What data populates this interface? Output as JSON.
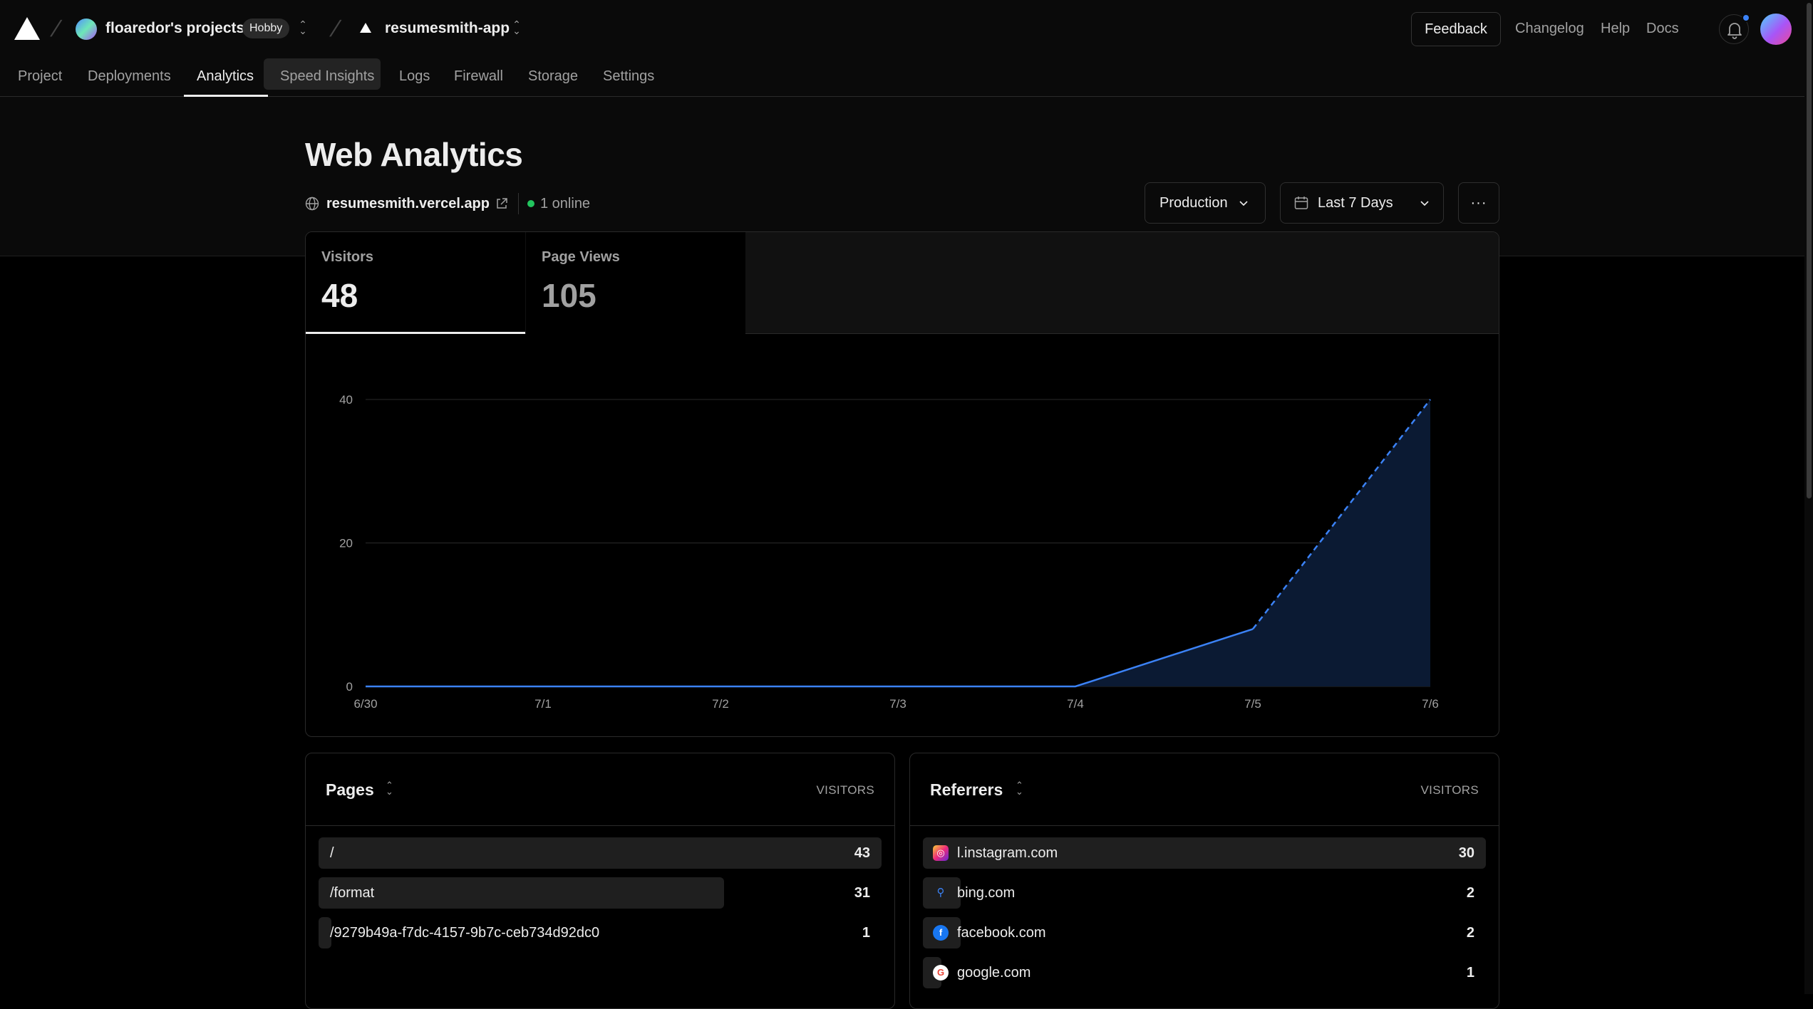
{
  "topbar": {
    "team_name": "floaredor's projects",
    "plan_badge": "Hobby",
    "project_name": "resumesmith-app",
    "feedback_label": "Feedback",
    "links": [
      "Changelog",
      "Help",
      "Docs"
    ]
  },
  "tabs": [
    {
      "label": "Project"
    },
    {
      "label": "Deployments"
    },
    {
      "label": "Analytics",
      "active": true
    },
    {
      "label": "Speed Insights"
    },
    {
      "label": "Logs"
    },
    {
      "label": "Firewall"
    },
    {
      "label": "Storage"
    },
    {
      "label": "Settings"
    }
  ],
  "header": {
    "title": "Web Analytics",
    "domain": "resumesmith.vercel.app",
    "online": "1 online",
    "environment": "Production",
    "range": "Last 7 Days",
    "more_label": "···"
  },
  "stats": [
    {
      "label": "Visitors",
      "value": "48",
      "active": true
    },
    {
      "label": "Page Views",
      "value": "105"
    }
  ],
  "chart_data": {
    "type": "area",
    "title": "",
    "xlabel": "",
    "ylabel": "",
    "categories": [
      "6/30",
      "7/1",
      "7/2",
      "7/3",
      "7/4",
      "7/5",
      "7/6"
    ],
    "ylim": [
      0,
      40
    ],
    "yticks": [
      0,
      20,
      40
    ],
    "grid": true,
    "series": [
      {
        "values": [
          0,
          0,
          0,
          0,
          0,
          8,
          40
        ],
        "color": "#3b82f6",
        "fill": "#0b1a33",
        "dashed_from_index": 5
      }
    ]
  },
  "pages_panel": {
    "title": "Pages",
    "column": "VISITORS",
    "rows": [
      {
        "label": "/",
        "value": "43",
        "share": 1.0
      },
      {
        "label": "/format",
        "value": "31",
        "share": 0.72
      },
      {
        "label": "/9279b49a-f7dc-4157-9b7c-ceb734d92dc0",
        "value": "1",
        "share": 0.023
      }
    ]
  },
  "referrers_panel": {
    "title": "Referrers",
    "column": "VISITORS",
    "rows": [
      {
        "label": "l.instagram.com",
        "value": "30",
        "share": 1.0,
        "icon": "instagram-icon"
      },
      {
        "label": "bing.com",
        "value": "2",
        "share": 0.067,
        "icon": "search-icon"
      },
      {
        "label": "facebook.com",
        "value": "2",
        "share": 0.067,
        "icon": "facebook-icon"
      },
      {
        "label": "google.com",
        "value": "1",
        "share": 0.033,
        "icon": "google-icon"
      }
    ]
  },
  "colors": {
    "accent": "#3b82f6",
    "online": "#22c55e"
  }
}
